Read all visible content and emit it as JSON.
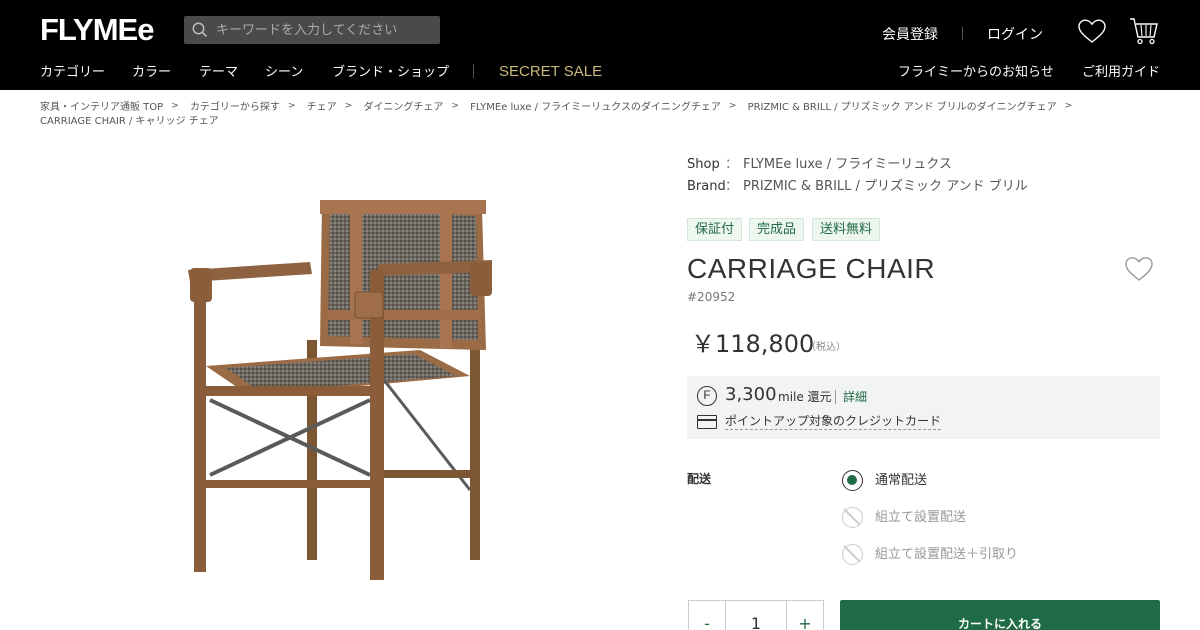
{
  "header": {
    "logo": "FLYMEe",
    "search_placeholder": "キーワードを入力してください",
    "register_label": "会員登録",
    "login_label": "ログイン",
    "nav": [
      "カテゴリー",
      "カラー",
      "テーマ",
      "シーン",
      "ブランド・ショップ"
    ],
    "sale_label": "SECRET SALE",
    "news_label": "フライミーからのお知らせ",
    "guide_label": "ご利用ガイド"
  },
  "breadcrumb": [
    "家具・インテリア通販 TOP",
    "カテゴリーから探す",
    "チェア",
    "ダイニングチェア",
    "FLYMEe luxe / フライミーリュクスのダイニングチェア",
    "PRIZMIC & BRILL / プリズミック アンド ブリルのダイニングチェア",
    "CARRIAGE CHAIR / キャリッジ チェア"
  ],
  "product": {
    "shop_key": "Shop",
    "shop_value": "FLYMEe luxe / フライミーリュクス",
    "brand_key": "Brand",
    "brand_value": "PRIZMIC & BRILL / プリズミック アンド ブリル",
    "tags": [
      "保証付",
      "完成品",
      "送料無料"
    ],
    "name": "CARRIAGE CHAIR",
    "sku": "#20952",
    "price": "￥118,800",
    "tax_note": "（税込）",
    "mile_value": "3,300",
    "mile_unit": "mile 還元",
    "mile_detail": "詳細",
    "card_link": "ポイントアップ対象のクレジットカード"
  },
  "shipping": {
    "label": "配送",
    "options": [
      {
        "label": "通常配送",
        "selected": true,
        "enabled": true
      },
      {
        "label": "組立て設置配送",
        "selected": false,
        "enabled": false
      },
      {
        "label": "組立て設置配送＋引取り",
        "selected": false,
        "enabled": false
      }
    ]
  },
  "purchase": {
    "minus": "-",
    "quantity": "1",
    "plus": "+",
    "cart_label": "カートに入れる"
  },
  "colors": {
    "header_bg": "#000000",
    "accent_green": "#1e6b45",
    "sale_gold": "#c9b87a"
  }
}
